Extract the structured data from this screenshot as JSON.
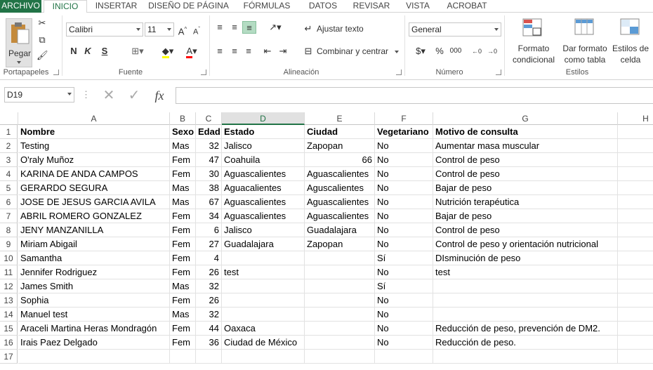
{
  "tabs": [
    "ARCHIVO",
    "INICIO",
    "INSERTAR",
    "DISEÑO DE PÁGINA",
    "FÓRMULAS",
    "DATOS",
    "REVISAR",
    "VISTA",
    "ACROBAT"
  ],
  "ribbon": {
    "portapapeles": {
      "label": "Portapapeles",
      "pegar": "Pegar"
    },
    "fuente": {
      "label": "Fuente",
      "font_name": "Calibri",
      "font_size": "11",
      "bold": "N",
      "italic": "K",
      "underline": "S"
    },
    "alineacion": {
      "label": "Alineación",
      "wrap": "Ajustar texto",
      "merge": "Combinar y centrar"
    },
    "numero": {
      "label": "Número",
      "format": "General",
      "currency": "$",
      "percent": "%",
      "thousands": "000"
    },
    "estilos": {
      "label": "Estilos",
      "cond_format_1": "Formato",
      "cond_format_2": "condicional",
      "table_format_1": "Dar formato",
      "table_format_2": "como tabla",
      "cell_styles_1": "Estilos de",
      "cell_styles_2": "celda"
    }
  },
  "formula_bar": {
    "name_box": "D19",
    "fx": "fx",
    "content": ""
  },
  "columns": [
    "A",
    "B",
    "C",
    "D",
    "E",
    "F",
    "G",
    "H"
  ],
  "selected_column": "D",
  "rows": [
    [
      "Nombre",
      "Sexo",
      "Edad",
      "Estado",
      "Ciudad",
      "Vegetariano",
      "Motivo de consulta"
    ],
    [
      "Testing",
      "Mas",
      "32",
      "Jalisco",
      "Zapopan",
      "No",
      "Aumentar masa muscular"
    ],
    [
      "O'raly Muñoz",
      "Fem",
      "47",
      "Coahuila",
      "66",
      "No",
      "Control de peso"
    ],
    [
      "KARINA DE ANDA CAMPOS",
      "Fem",
      "30",
      "Aguascalientes",
      "Aguascalientes",
      "No",
      "Control de peso"
    ],
    [
      "GERARDO SEGURA",
      "Mas",
      "38",
      "Aguacalientes",
      "Aguscalientes",
      "No",
      "Bajar de peso"
    ],
    [
      "JOSE DE JESUS GARCIA AVILA",
      "Mas",
      "67",
      "Aguascalientes",
      "Aguascalientes",
      "No",
      "Nutrición terapéutica"
    ],
    [
      "ABRIL ROMERO GONZALEZ",
      "Fem",
      "34",
      "Aguascalientes",
      "Aguascalientes",
      "No",
      "Bajar de peso"
    ],
    [
      "JENY MANZANILLA",
      "Fem",
      "6",
      "Jalisco",
      "Guadalajara",
      "No",
      "Control de peso"
    ],
    [
      "Miriam Abigail",
      "Fem",
      "27",
      "Guadalajara",
      "Zapopan",
      "No",
      "Control de peso y orientación nutricional"
    ],
    [
      "Samantha",
      "Fem",
      "4",
      "",
      "",
      "Sí",
      "DIsminución de peso"
    ],
    [
      "Jennifer Rodriguez",
      "Fem",
      "26",
      "test",
      "",
      "No",
      "test"
    ],
    [
      "James Smith",
      "Mas",
      "32",
      "",
      "",
      "Sí",
      ""
    ],
    [
      "Sophia",
      "Fem",
      "26",
      "",
      "",
      "No",
      ""
    ],
    [
      "Manuel test",
      "Mas",
      "32",
      "",
      "",
      "No",
      ""
    ],
    [
      "Araceli Martina Heras Mondragón",
      "Fem",
      "44",
      "Oaxaca",
      "",
      "No",
      "Reducción de peso, prevención de DM2."
    ],
    [
      "Irais Paez Delgado",
      "Fem",
      "36",
      "Ciudad de México",
      "",
      "No",
      "Reducción de peso."
    ],
    [
      "",
      "",
      "",
      "",
      "",
      "",
      ""
    ]
  ],
  "colors": {
    "accent": "#217346"
  }
}
